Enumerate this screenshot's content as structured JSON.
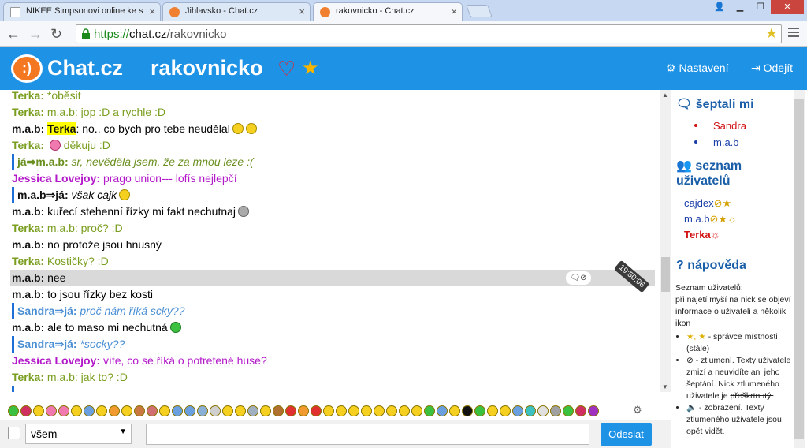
{
  "browser": {
    "tabs": [
      {
        "title": "NIKEE Simpsonovi online ke s",
        "icon": "document-icon"
      },
      {
        "title": "Jihlavsko - Chat.cz",
        "icon": "chat-icon"
      },
      {
        "title": "rakovnicko - Chat.cz",
        "icon": "chat-icon",
        "active": true
      }
    ],
    "url_scheme": "https://",
    "url_host": "chat.cz",
    "url_path": "/rakovnicko"
  },
  "header": {
    "logo_symbol": ":)",
    "logo_text": "Chat.cz",
    "room_name": "rakovnicko",
    "settings_label": "Nastavení",
    "logout_label": "Odejít",
    "brand_color": "#1e93e6"
  },
  "messages": [
    {
      "nick": "Terka:",
      "text": "*oběsit",
      "type": "terka"
    },
    {
      "nick": "Terka:",
      "text": "m.a.b: jop :D a rychle :D",
      "type": "terka"
    },
    {
      "nick": "m.a.b:",
      "mention": "Terka",
      "text": ": no.. co bych pro tebe neudělal",
      "type": "mab"
    },
    {
      "nick": "Terka:",
      "text": "děkuju :D",
      "type": "terka"
    },
    {
      "nick": "já⇒m.a.b:",
      "text": "sr, nevěděla jsem, že za mnou leze :(",
      "type": "ja-pm"
    },
    {
      "nick": "Jessica Lovejoy:",
      "text": "prago union--- lofís nejlepčí",
      "type": "jessica"
    },
    {
      "nick": "m.a.b⇒já:",
      "text": "však cajk",
      "type": "mab-pm"
    },
    {
      "nick": "m.a.b:",
      "text": "kuřecí stehenní řízky mi fakt nechutnaj",
      "type": "mab"
    },
    {
      "nick": "Terka:",
      "text": "m.a.b: proč? :D",
      "type": "terka"
    },
    {
      "nick": "m.a.b:",
      "text": "no protože jsou hnusný",
      "type": "mab"
    },
    {
      "nick": "Terka:",
      "text": "Kostičky? :D",
      "type": "terka"
    },
    {
      "nick": "m.a.b:",
      "text": "nee",
      "type": "mab",
      "highlight": true
    },
    {
      "nick": "m.a.b:",
      "text": "to jsou řízky bez kosti",
      "type": "mab"
    },
    {
      "nick": "Sandra⇒já:",
      "text": "proč nám říká scky??",
      "type": "sandra-pm"
    },
    {
      "nick": "m.a.b:",
      "text": "ale to maso mi nechutná",
      "type": "mab"
    },
    {
      "nick": "Sandra⇒já:",
      "text": "*socky??",
      "type": "sandra-pm"
    },
    {
      "nick": "Jessica Lovejoy:",
      "text": "víte, co se říká o potrefené huse?",
      "type": "jessica"
    },
    {
      "nick": "Terka:",
      "text": "m.a.b: jak to? :D",
      "type": "terka"
    }
  ],
  "hover_timestamp": "19:50:06",
  "sidebar": {
    "whispered_heading": "šeptali mi",
    "whispered": [
      {
        "name": "Sandra",
        "color": "#d01010"
      },
      {
        "name": "m.a.b",
        "color": "#1b3fa8"
      }
    ],
    "users_heading": "seznam uživatelů",
    "users": [
      {
        "name": "cajdex",
        "color": "#1b3fa8",
        "icons": "⊘★"
      },
      {
        "name": "m.a.b",
        "color": "#1b3fa8",
        "icons": "⊘★☼"
      },
      {
        "name": "Terka",
        "color": "#d01010",
        "icons": "☼"
      }
    ],
    "help_heading": "nápověda",
    "help_intro": "Seznam uživatelů:",
    "help_text": "při najetí myší na nick se objeví informace o uživateli a několik ikon",
    "help_items": [
      "- správce místnosti (stále)",
      "- ztlumení. Texty uživatele zmizí a neuvidíte ani jeho šeptání. Nick ztlumeného uživatele je",
      "- zobrazení. Texty ztlumeného uživatele jsou opět vidět."
    ],
    "help_strike": "přeškrtnutý."
  },
  "composer": {
    "recipient_value": "všem",
    "send_label": "Odeslat",
    "message_value": ""
  }
}
